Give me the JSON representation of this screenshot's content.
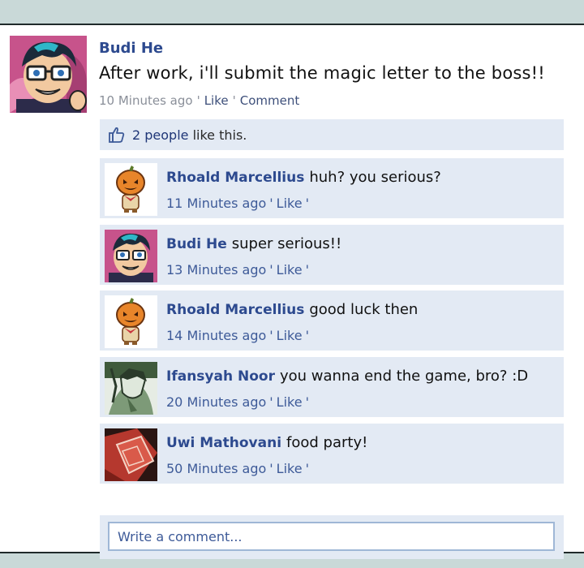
{
  "post": {
    "author": "Budi He",
    "text": "After work, i'll submit the magic letter to the boss!!",
    "time": "10 Minutes ago",
    "like_label": "Like",
    "comment_label": "Comment",
    "likes_count_text": "2 people",
    "likes_rest_text": "like this."
  },
  "comments": [
    {
      "author": "Rhoald Marcellius",
      "text": "huh? you serious?",
      "time": "11 Minutes ago",
      "like_label": "Like"
    },
    {
      "author": "Budi He",
      "text": "super serious!!",
      "time": "13 Minutes ago",
      "like_label": "Like"
    },
    {
      "author": "Rhoald Marcellius",
      "text": "good luck then",
      "time": "14 Minutes ago",
      "like_label": "Like"
    },
    {
      "author": "Ifansyah Noor",
      "text": "you wanna end the game, bro? :D",
      "time": "20 Minutes ago",
      "like_label": "Like"
    },
    {
      "author": "Uwi Mathovani",
      "text": "food party!",
      "time": "50 Minutes ago",
      "like_label": "Like"
    }
  ],
  "write_comment": {
    "placeholder": "Write a comment..."
  },
  "separator": "'",
  "icons": {
    "like": "thumbs-up-icon",
    "avatar_budi": "avatar-budi-he",
    "avatar_rhoald": "avatar-rhoald-marcellius",
    "avatar_ifansyah": "avatar-ifansyah-noor",
    "avatar_uwi": "avatar-uwi-mathovani"
  },
  "colors": {
    "name_blue": "#2d4a8f",
    "panel_bg": "#e3eaf4",
    "page_bg": "#c9d9d8",
    "meta_gray": "#8a8f99"
  }
}
